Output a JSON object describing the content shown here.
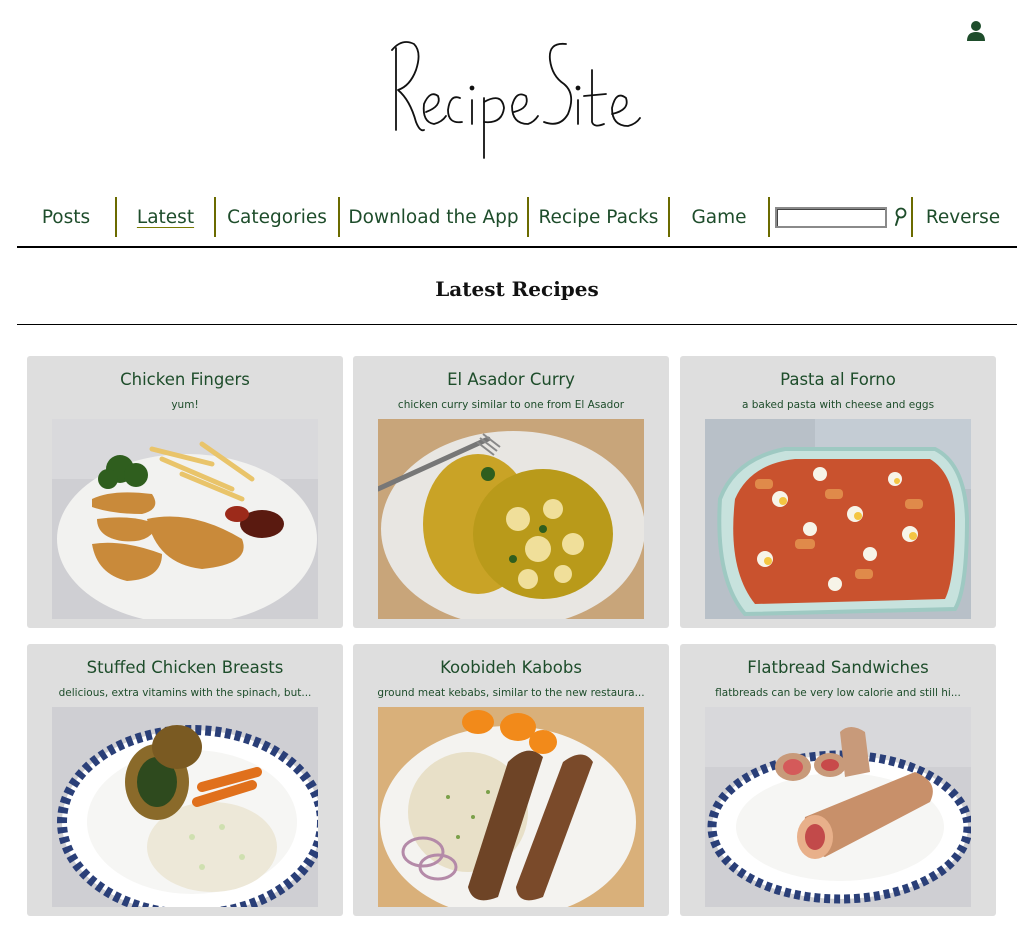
{
  "header": {
    "logo_text": "RecipeSite",
    "user_icon": "user-icon"
  },
  "nav": {
    "items": [
      {
        "label": "Posts",
        "active": false
      },
      {
        "label": "Latest",
        "active": true
      },
      {
        "label": "Categories",
        "active": false
      },
      {
        "label": "Download the App",
        "active": false
      },
      {
        "label": "Recipe Packs",
        "active": false
      },
      {
        "label": "Game",
        "active": false
      }
    ],
    "search": {
      "value": "",
      "placeholder": "",
      "icon": "search-icon"
    },
    "reverse_label": "Reverse"
  },
  "page": {
    "title": "Latest Recipes"
  },
  "colors": {
    "accent_green": "#1e4d2b",
    "separator": "#6b6b00",
    "card_bg": "#dedede"
  },
  "recipes": [
    {
      "title": "Chicken Fingers",
      "description": "yum!"
    },
    {
      "title": "El Asador Curry",
      "description": "chicken curry similar to one from El Asador"
    },
    {
      "title": "Pasta al Forno",
      "description": "a baked pasta with cheese and eggs"
    },
    {
      "title": "Stuffed Chicken Breasts",
      "description": "delicious, extra vitamins with the spinach, but..."
    },
    {
      "title": "Koobideh Kabobs",
      "description": "ground meat kebabs, similar to the new restaura..."
    },
    {
      "title": "Flatbread Sandwiches",
      "description": "flatbreads can be very low calorie and still hi..."
    }
  ]
}
